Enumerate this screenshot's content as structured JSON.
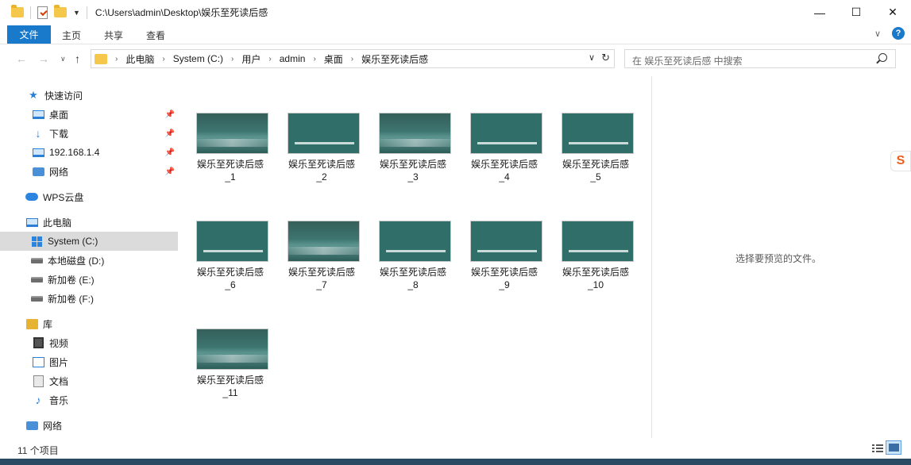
{
  "window": {
    "title": "C:\\Users\\admin\\Desktop\\娱乐至死读后感",
    "minimize": "—",
    "maximize": "☐",
    "close": "✕"
  },
  "ribbon": {
    "tabs": [
      "文件",
      "主页",
      "共享",
      "查看"
    ],
    "help": "?"
  },
  "address": {
    "crumbs": [
      "此电脑",
      "System (C:)",
      "用户",
      "admin",
      "桌面",
      "娱乐至死读后感"
    ],
    "search_placeholder": "在 娱乐至死读后感 中搜索"
  },
  "sidebar": {
    "items": [
      {
        "label": "快速访问",
        "icon": "star-icon"
      },
      {
        "label": "桌面",
        "icon": "desktop-icon",
        "pinned": true
      },
      {
        "label": "下载",
        "icon": "download-icon",
        "pinned": true
      },
      {
        "label": "192.168.1.4",
        "icon": "network-drive-icon",
        "pinned": true
      },
      {
        "label": "网络",
        "icon": "network-icon",
        "pinned": true
      },
      {
        "label": "WPS云盘",
        "icon": "cloud-icon"
      },
      {
        "label": "此电脑",
        "icon": "computer-icon"
      },
      {
        "label": "System (C:)",
        "icon": "system-drive-icon",
        "selected": true
      },
      {
        "label": "本地磁盘 (D:)",
        "icon": "drive-icon"
      },
      {
        "label": "新加卷 (E:)",
        "icon": "drive-icon"
      },
      {
        "label": "新加卷 (F:)",
        "icon": "drive-icon"
      },
      {
        "label": "库",
        "icon": "library-icon"
      },
      {
        "label": "视频",
        "icon": "video-icon"
      },
      {
        "label": "图片",
        "icon": "pictures-icon"
      },
      {
        "label": "文档",
        "icon": "documents-icon"
      },
      {
        "label": "音乐",
        "icon": "music-icon"
      },
      {
        "label": "网络",
        "icon": "network-icon"
      }
    ]
  },
  "files": [
    {
      "line1": "娱乐至死读后感",
      "line2": "_1",
      "style": "wave"
    },
    {
      "line1": "娱乐至死读后感",
      "line2": "_2",
      "style": "plain"
    },
    {
      "line1": "娱乐至死读后感",
      "line2": "_3",
      "style": "wave"
    },
    {
      "line1": "娱乐至死读后感",
      "line2": "_4",
      "style": "plain"
    },
    {
      "line1": "娱乐至死读后感",
      "line2": "_5",
      "style": "plain"
    },
    {
      "line1": "娱乐至死读后感",
      "line2": "_6",
      "style": "plain"
    },
    {
      "line1": "娱乐至死读后感",
      "line2": "_7",
      "style": "wave"
    },
    {
      "line1": "娱乐至死读后感",
      "line2": "_8",
      "style": "plain"
    },
    {
      "line1": "娱乐至死读后感",
      "line2": "_9",
      "style": "plain"
    },
    {
      "line1": "娱乐至死读后感",
      "line2": "_10",
      "style": "plain"
    },
    {
      "line1": "娱乐至死读后感",
      "line2": "_11",
      "style": "wave"
    }
  ],
  "preview": {
    "empty_text": "选择要预览的文件。"
  },
  "status": {
    "count": "11 个项目"
  }
}
